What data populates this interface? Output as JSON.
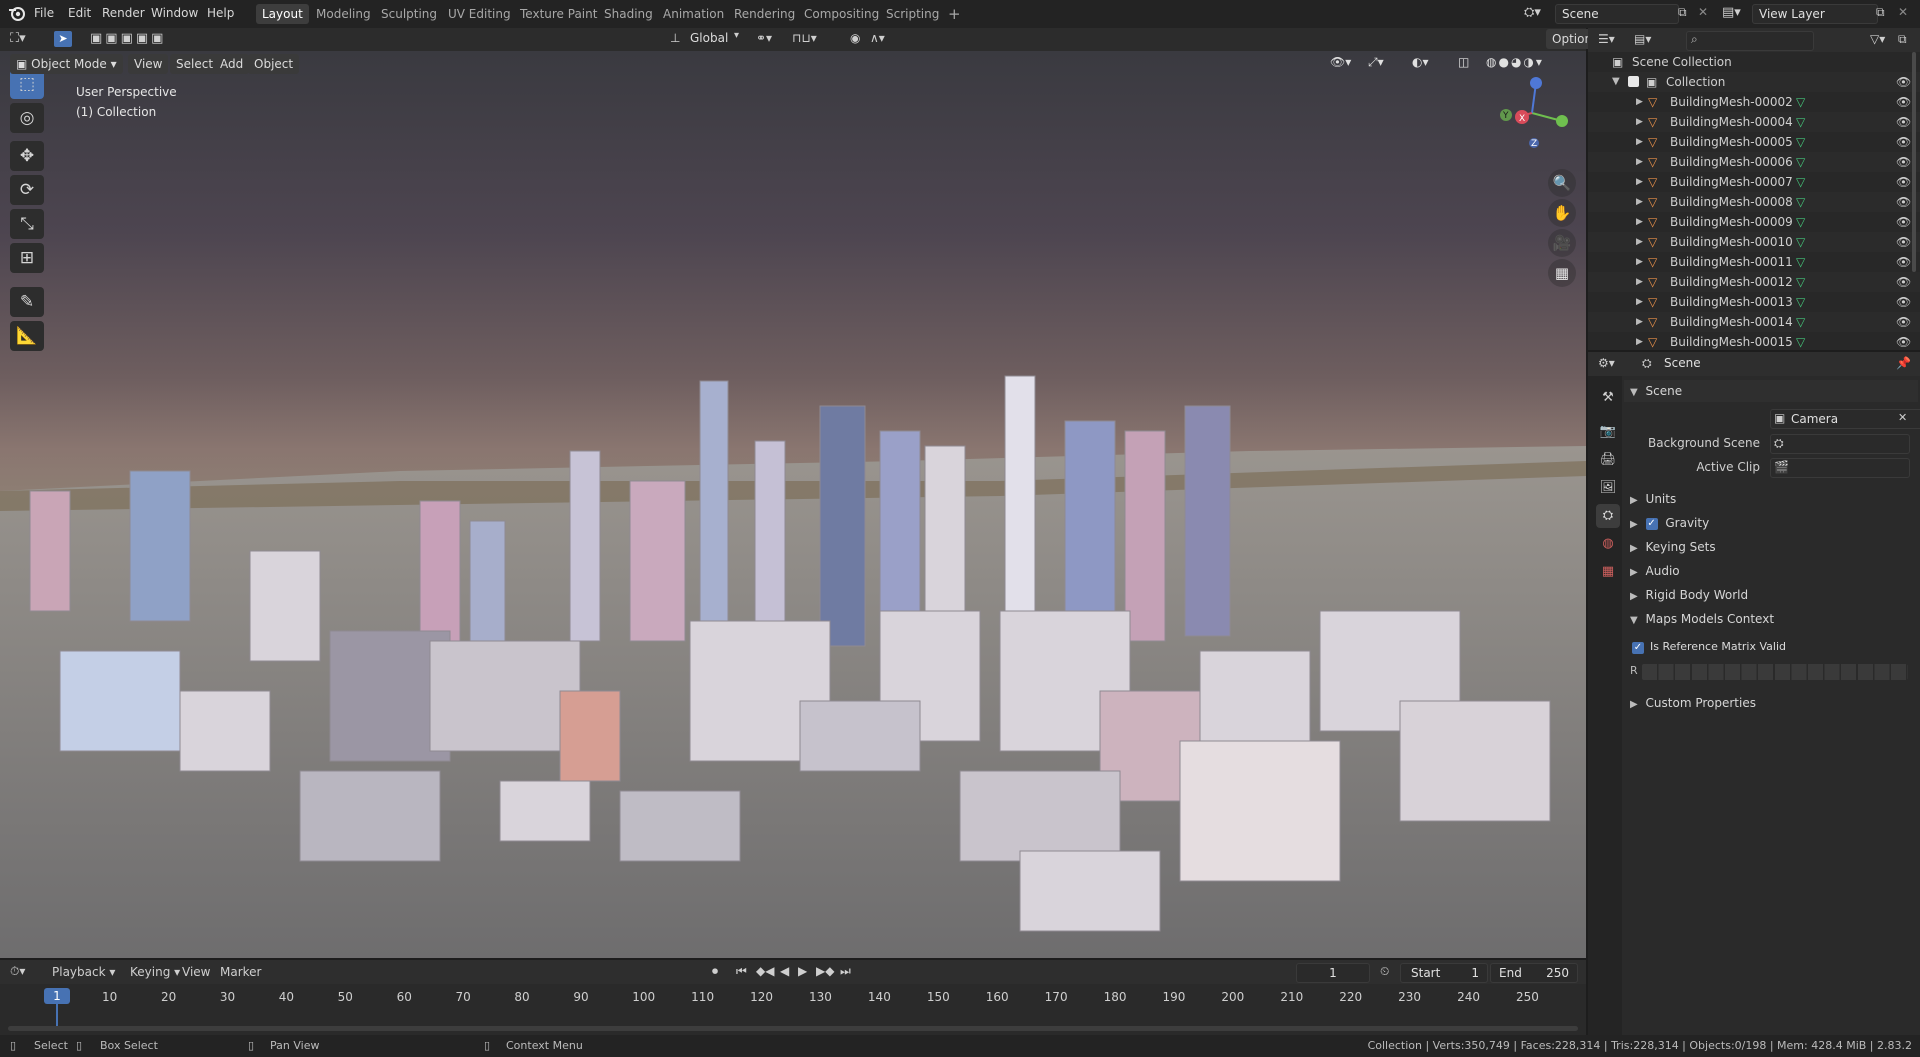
{
  "menubar": {
    "menus": [
      "File",
      "Edit",
      "Render",
      "Window",
      "Help"
    ],
    "workspaces": [
      "Layout",
      "Modeling",
      "Sculpting",
      "UV Editing",
      "Texture Paint",
      "Shading",
      "Animation",
      "Rendering",
      "Compositing",
      "Scripting"
    ],
    "active_workspace": "Layout",
    "scene_label": "Scene",
    "view_layer_label": "View Layer"
  },
  "viewport_header": {
    "transform_orientation": "Global",
    "options_label": "Options"
  },
  "viewport_subheader": {
    "mode": "Object Mode",
    "menus": [
      "View",
      "Select",
      "Add",
      "Object"
    ]
  },
  "viewport": {
    "perspective_label": "User Perspective",
    "collection_label": "(1) Collection",
    "gizmo_axes": [
      "X",
      "Y",
      "Z"
    ]
  },
  "outliner": {
    "search_placeholder": "",
    "root": "Scene Collection",
    "collection": "Collection",
    "items": [
      "BuildingMesh-00002",
      "BuildingMesh-00004",
      "BuildingMesh-00005",
      "BuildingMesh-00006",
      "BuildingMesh-00007",
      "BuildingMesh-00008",
      "BuildingMesh-00009",
      "BuildingMesh-00010",
      "BuildingMesh-00011",
      "BuildingMesh-00012",
      "BuildingMesh-00013",
      "BuildingMesh-00014",
      "BuildingMesh-00015"
    ]
  },
  "properties": {
    "header_title": "Scene",
    "scene_panel": "Scene",
    "camera_label": "Camera",
    "camera_value": "Camera",
    "background_scene_label": "Background Scene",
    "active_clip_label": "Active Clip",
    "panels": [
      "Units",
      "Gravity",
      "Keying Sets",
      "Audio",
      "Rigid Body World",
      "Maps Models Context"
    ],
    "gravity_checked": true,
    "reference_matrix_label": "Is Reference Matrix Valid",
    "reference_matrix_checked": true,
    "r_label": "R",
    "custom_properties": "Custom Properties"
  },
  "timeline": {
    "menus": [
      "Playback",
      "Keying",
      "View",
      "Marker"
    ],
    "current_frame": "1",
    "start_label": "Start",
    "start_value": "1",
    "end_label": "End",
    "end_value": "250",
    "ticks": [
      "1",
      "10",
      "20",
      "30",
      "40",
      "50",
      "60",
      "70",
      "80",
      "90",
      "100",
      "110",
      "120",
      "130",
      "140",
      "150",
      "160",
      "170",
      "180",
      "190",
      "200",
      "210",
      "220",
      "230",
      "240",
      "250"
    ]
  },
  "statusbar": {
    "select": "Select",
    "box_select": "Box Select",
    "pan_view": "Pan View",
    "context_menu": "Context Menu",
    "stats": "Collection | Verts:350,749 | Faces:228,314 | Tris:228,314 | Objects:0/198 | Mem: 428.4 MiB | 2.83.2"
  },
  "colors": {
    "accent": "#4772b3",
    "mesh_icon": "#e8904a",
    "data_icon": "#44c47a"
  }
}
